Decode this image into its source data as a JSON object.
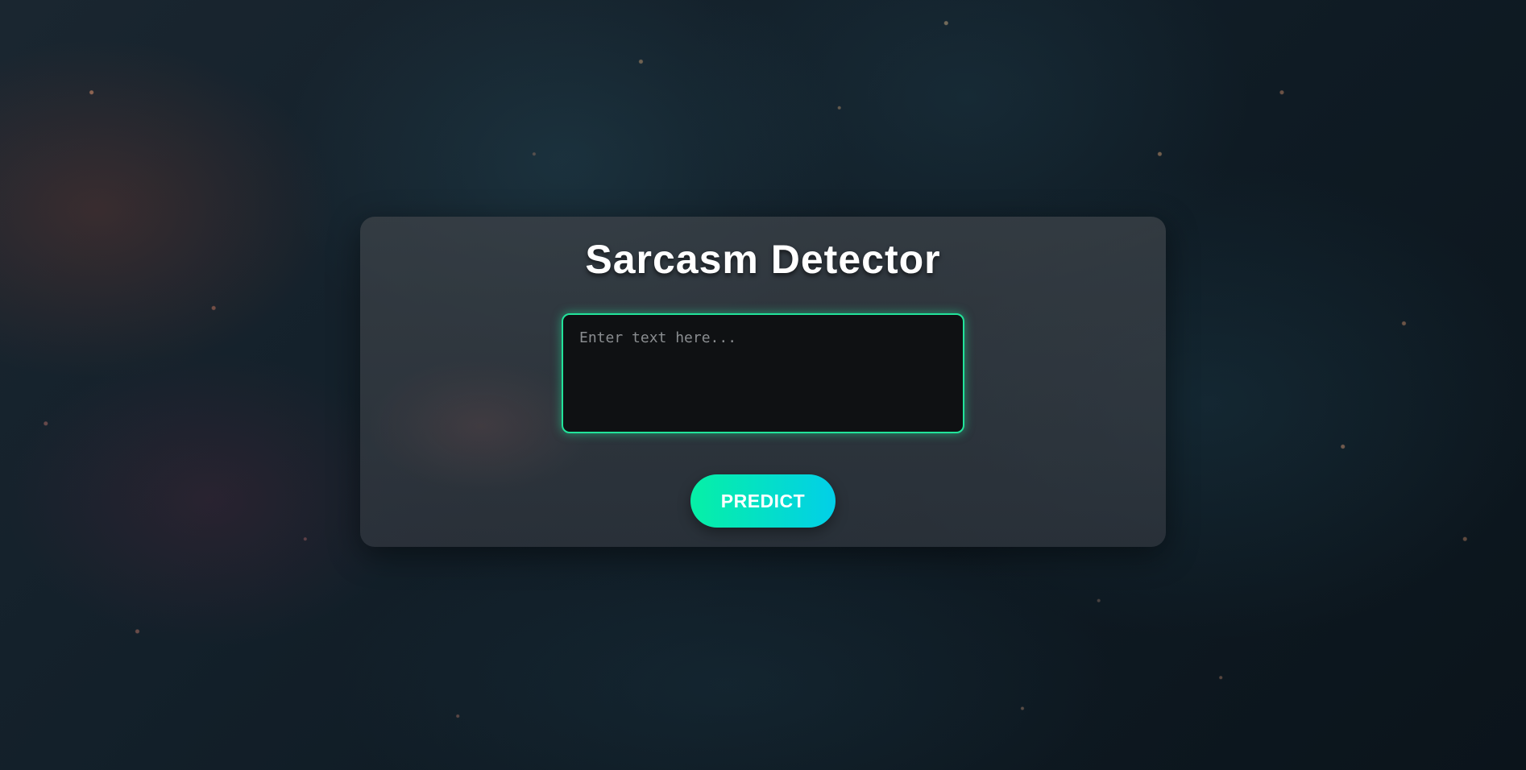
{
  "page": {
    "title": "Sarcasm Detector"
  },
  "form": {
    "input_placeholder": "Enter text here...",
    "input_value": "",
    "predict_label": "PREDICT"
  },
  "colors": {
    "accent_green": "#22e39a",
    "button_gradient_start": "#06f0a6",
    "button_gradient_end": "#02cfe8",
    "card_background": "#3c4248",
    "page_background": "#13202a"
  }
}
